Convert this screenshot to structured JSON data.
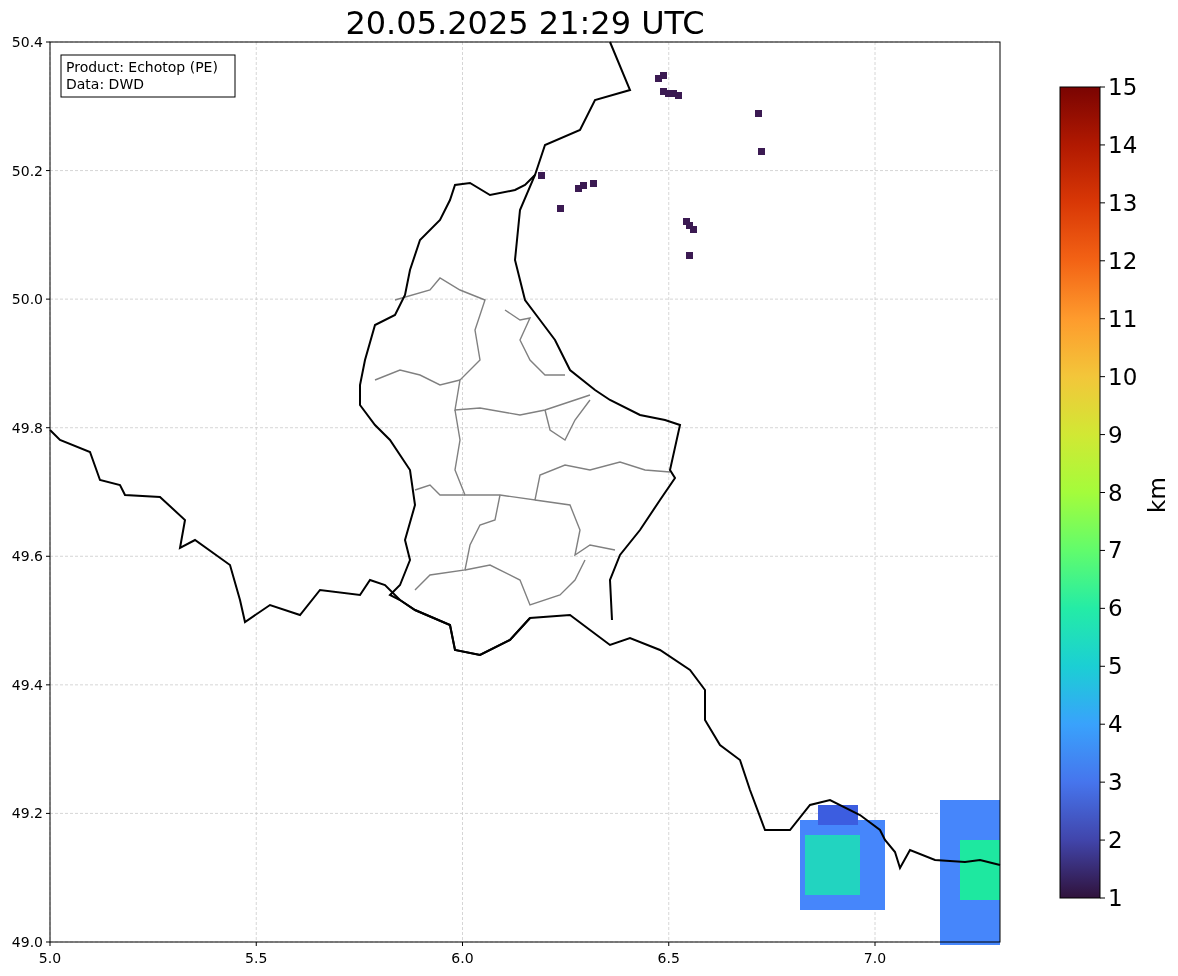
{
  "title": "20.05.2025 21:29 UTC",
  "info_box": [
    "Product: Echotop (PE)",
    "Data: DWD"
  ],
  "map": {
    "xticks": [
      "5.0",
      "5.5",
      "6.0",
      "6.5",
      "7.0"
    ],
    "yticks": [
      "50.4",
      "50.2",
      "50.0",
      "49.8",
      "49.6",
      "49.4",
      "49.2",
      "49.0"
    ]
  },
  "colorbar": {
    "label": "km",
    "ticks": [
      "15",
      "14",
      "13",
      "12",
      "11",
      "10",
      "9",
      "8",
      "7",
      "6",
      "5",
      "4",
      "3",
      "2",
      "1"
    ]
  }
}
